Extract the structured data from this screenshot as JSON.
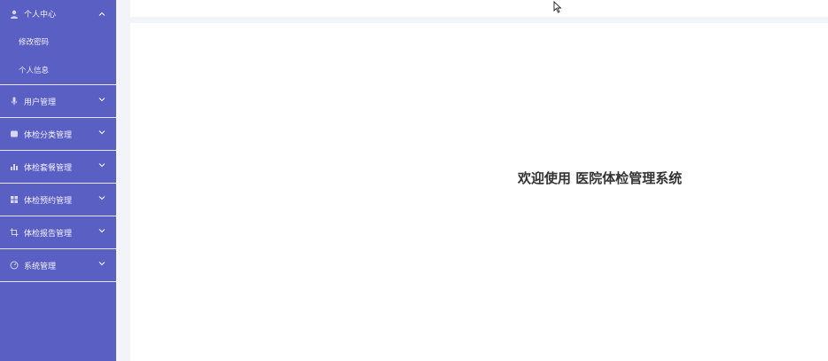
{
  "sidebar": {
    "groups": [
      {
        "label": "个人中心",
        "icon": "user-icon",
        "expanded": true,
        "items": [
          {
            "label": "修改密码"
          },
          {
            "label": "个人信息"
          }
        ]
      },
      {
        "label": "用户管理",
        "icon": "microphone-icon",
        "expanded": false
      },
      {
        "label": "体检分类管理",
        "icon": "database-icon",
        "expanded": false
      },
      {
        "label": "体检套餐管理",
        "icon": "bar-chart-icon",
        "expanded": false
      },
      {
        "label": "体检预约管理",
        "icon": "grid-icon",
        "expanded": false
      },
      {
        "label": "体检报告管理",
        "icon": "crop-icon",
        "expanded": false
      },
      {
        "label": "系统管理",
        "icon": "dashboard-icon",
        "expanded": false
      }
    ]
  },
  "main": {
    "welcome_text": "欢迎使用 医院体检管理系统"
  },
  "colors": {
    "sidebar_bg": "#5a5fc3",
    "page_bg": "#f3f4f7",
    "content_bg": "#ffffff",
    "welcome_text": "#333333"
  }
}
